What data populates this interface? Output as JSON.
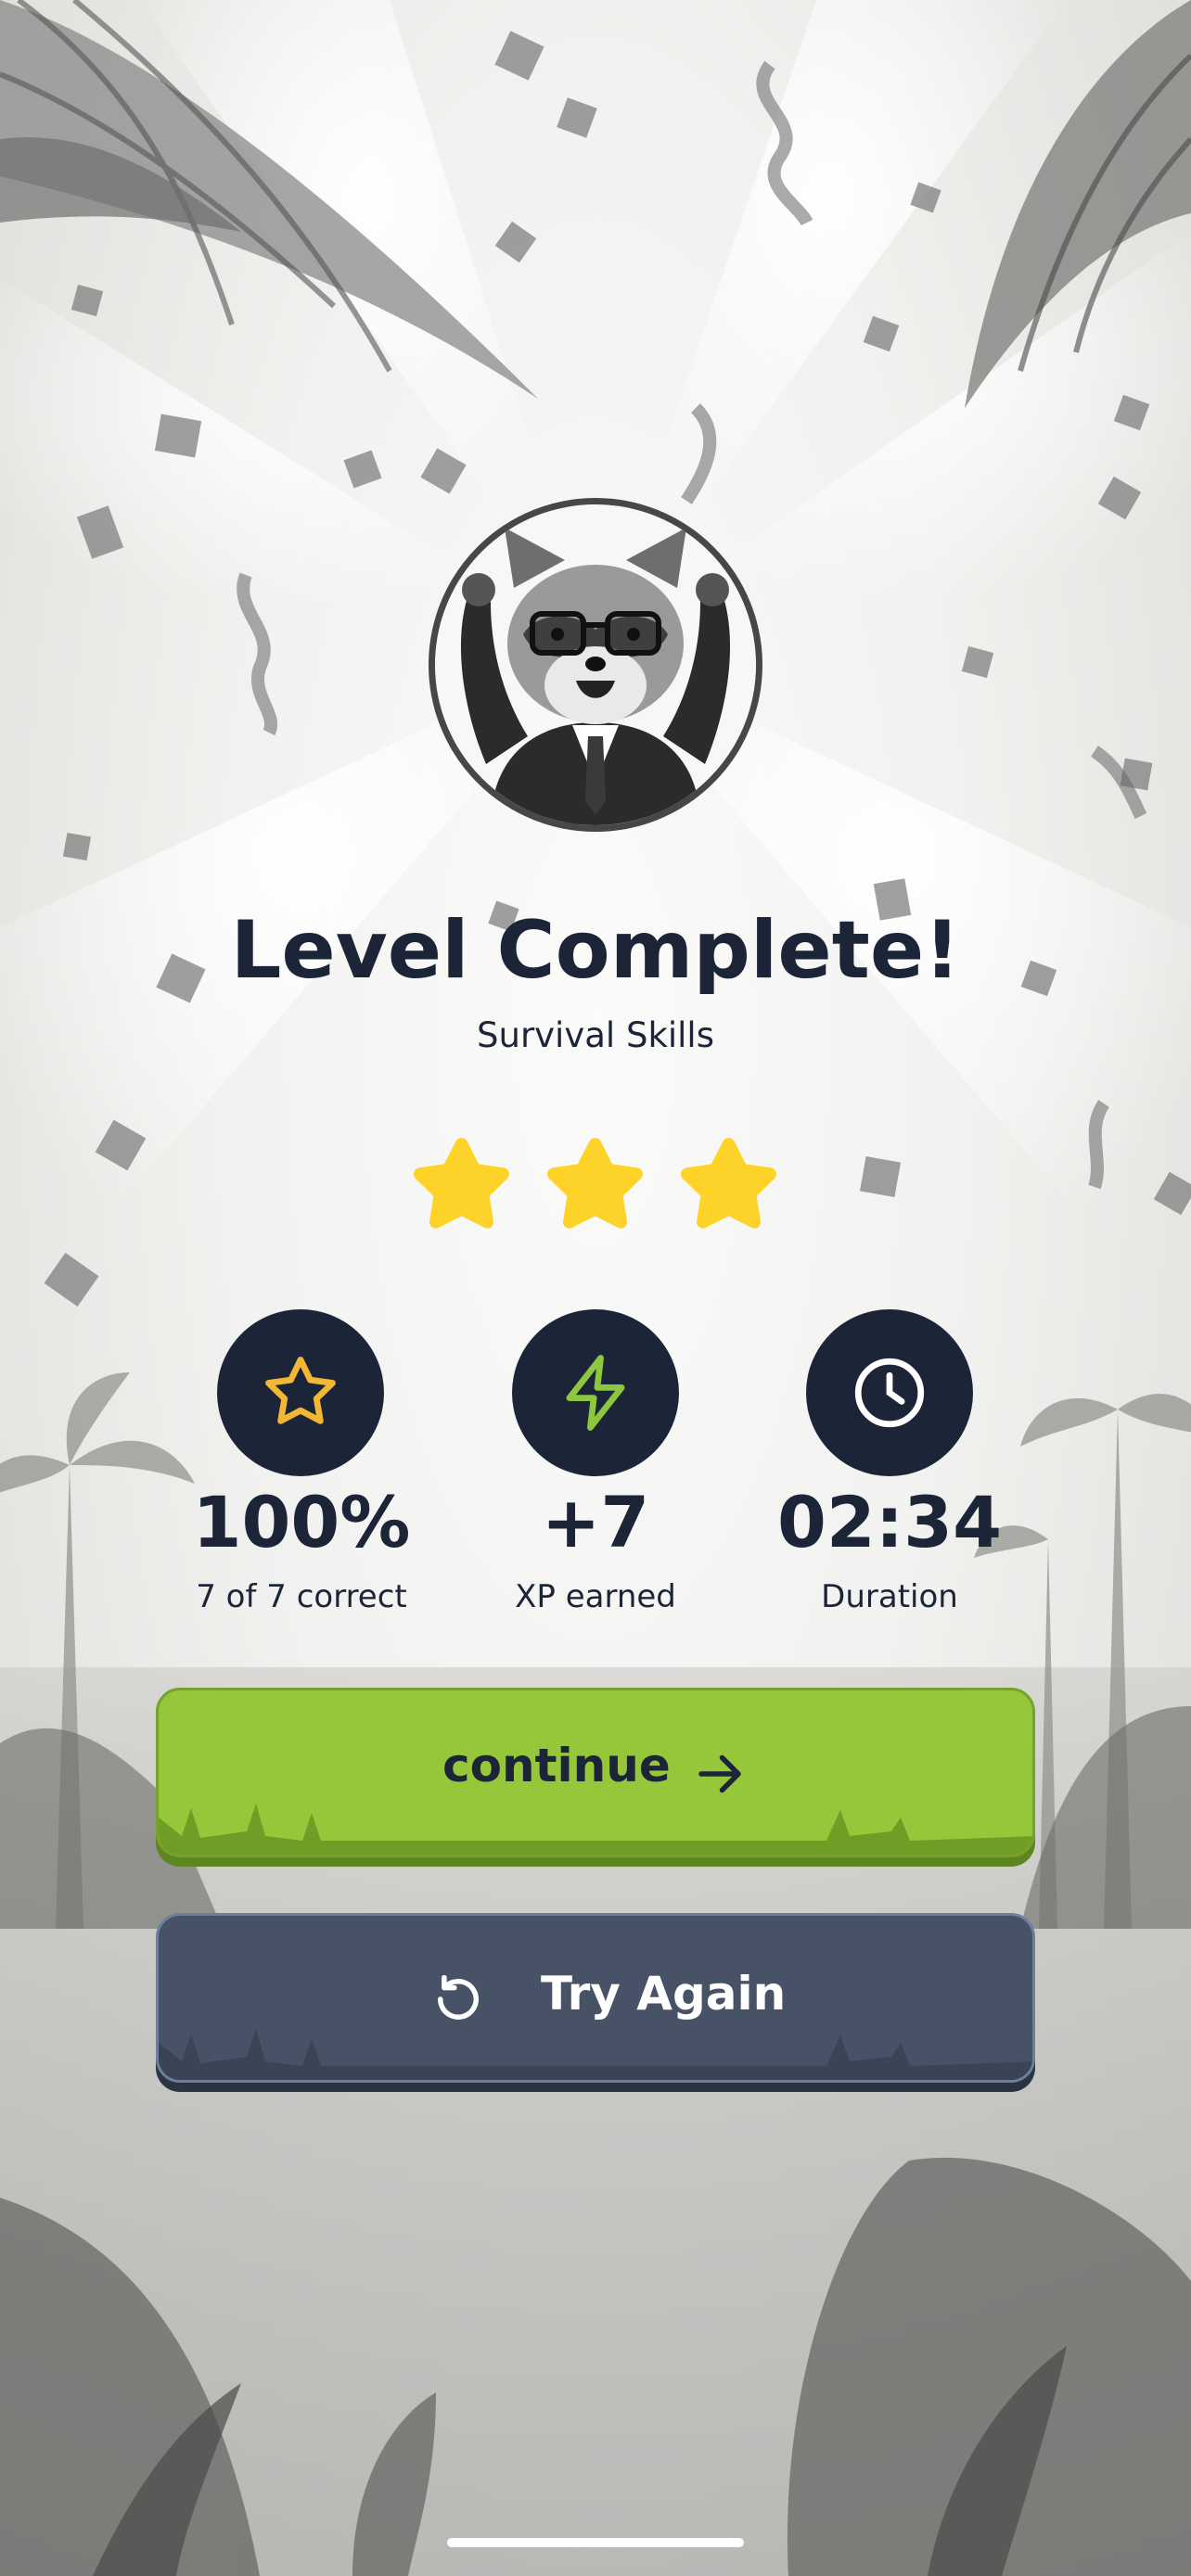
{
  "level": {
    "title": "Level Complete!",
    "subtitle": "Survival Skills",
    "stars_earned": 3,
    "stars_total": 3
  },
  "avatar": {
    "icon": "raccoon-mascot-celebrating"
  },
  "stats": [
    {
      "icon": "star-outline-icon",
      "icon_color": "#f2b833",
      "value": "100%",
      "label": "7 of 7 correct"
    },
    {
      "icon": "lightning-icon",
      "icon_color": "#8dc63f",
      "value": "+7",
      "label": "XP earned"
    },
    {
      "icon": "clock-icon",
      "icon_color": "#ffffff",
      "value": "02:34",
      "label": "Duration"
    }
  ],
  "buttons": {
    "continue": {
      "label": "continue",
      "icon": "arrow-right-icon",
      "color": "#96c639"
    },
    "try_again": {
      "label": "Try Again",
      "icon": "retry-icon",
      "color": "#475266"
    }
  },
  "colors": {
    "text": "#1c2538",
    "star": "#fdd32a",
    "stat_circle": "#1c2538"
  }
}
